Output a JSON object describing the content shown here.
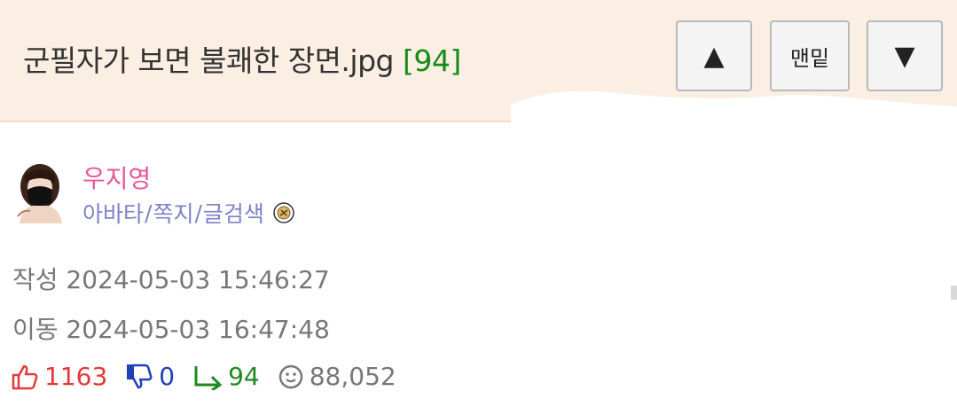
{
  "header": {
    "title": "군필자가 보면 불쾌한 장면.jpg",
    "comment_count": "[94]",
    "up_label": "▲",
    "bottom_label": "맨밑",
    "down_label": "▼"
  },
  "author": {
    "name": "우지영",
    "links": [
      "아바타",
      "쪽지",
      "글검색"
    ],
    "separator": "/",
    "badge_icon": "level-badge-icon"
  },
  "meta": {
    "created": "작성 2024-05-03 15:46:27",
    "moved": "이동 2024-05-03 16:47:48"
  },
  "stats": {
    "likes": "1163",
    "dislikes": "0",
    "replies": "94",
    "views": "88,052"
  },
  "colors": {
    "header_bg": "#fbefe4",
    "comment_count": "#178a17",
    "author_name": "#e8559a",
    "links": "#7d82c9",
    "like": "#e23a3a",
    "dislike": "#2040b8",
    "reply": "#1f8a1f",
    "meta": "#777777"
  }
}
